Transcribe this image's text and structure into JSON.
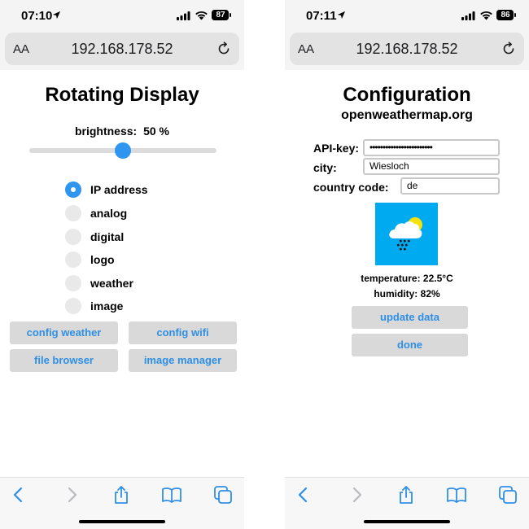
{
  "accent_color": "#2f96f0",
  "link_color": "#2f8fe6",
  "weather_tile_color": "#00aaf0",
  "left": {
    "status": {
      "time": "07:10",
      "battery": "87"
    },
    "browser": {
      "aa": "AA",
      "url": "192.168.178.52"
    },
    "page": {
      "title": "Rotating Display",
      "brightness_label": "brightness:",
      "brightness_value": "50 %",
      "brightness_level": 0.5,
      "modes": [
        {
          "label": "IP address",
          "checked": true
        },
        {
          "label": "analog",
          "checked": false
        },
        {
          "label": "digital",
          "checked": false
        },
        {
          "label": "logo",
          "checked": false
        },
        {
          "label": "weather",
          "checked": false
        },
        {
          "label": "image",
          "checked": false
        }
      ],
      "buttons": {
        "config_weather": "config weather",
        "config_wifi": "config wifi",
        "file_browser": "file browser",
        "image_manager": "image manager"
      }
    }
  },
  "right": {
    "status": {
      "time": "07:11",
      "battery": "86"
    },
    "browser": {
      "aa": "AA",
      "url": "192.168.178.52"
    },
    "page": {
      "title": "Configuration",
      "subtitle": "openweathermap.org",
      "api_key_label": "API-key:",
      "api_key_value": "••••••••••••••••••••••••",
      "city_label": "city:",
      "city_value": "Wiesloch",
      "country_label": "country code:",
      "country_value": "de",
      "temperature": "temperature: 22.5°C",
      "humidity": "humidity: 82%",
      "update_button": "update data",
      "done_button": "done"
    }
  },
  "icons": {
    "location": "location-arrow-icon",
    "signal": "cellular-signal-icon",
    "wifi": "wifi-icon",
    "battery": "battery-icon",
    "reload": "reload-icon",
    "back": "back-chevron-icon",
    "forward": "forward-chevron-icon",
    "share": "share-icon",
    "bookmarks": "bookmarks-book-icon",
    "tabs": "tabs-icon",
    "weather": "cloud-sun-rain-icon"
  }
}
